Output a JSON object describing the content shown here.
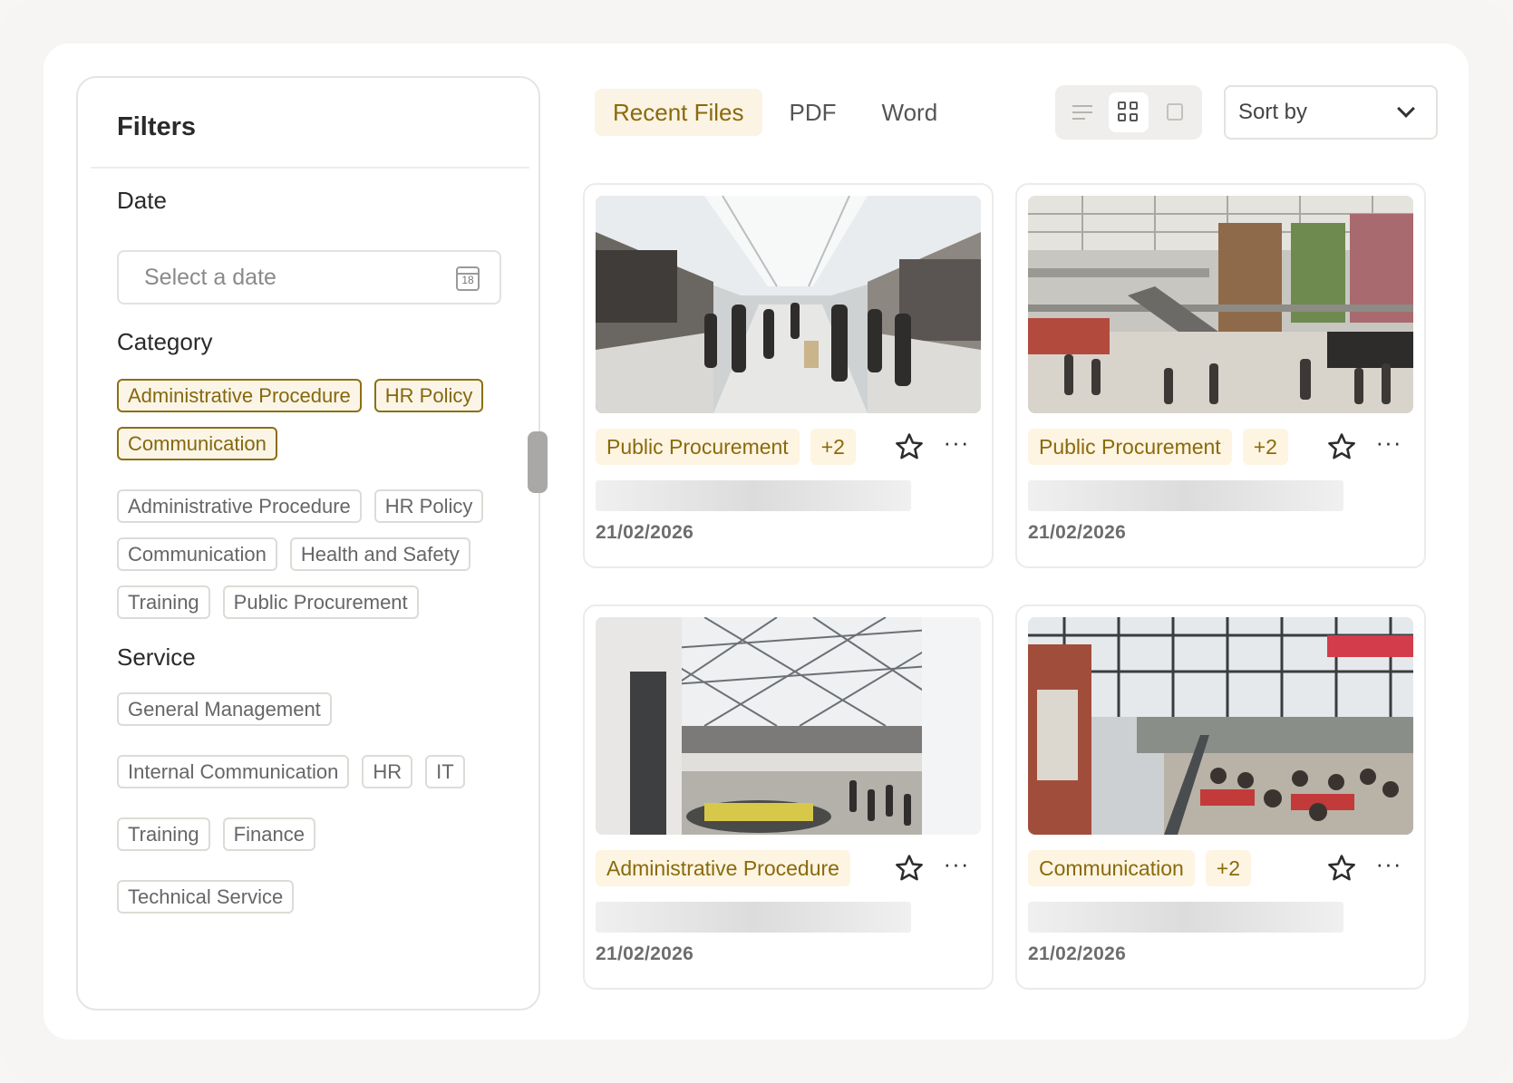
{
  "filters": {
    "title": "Filters",
    "date": {
      "label": "Date",
      "placeholder": "Select a date",
      "calendar_day": "18"
    },
    "category": {
      "label": "Category",
      "selected": [
        "Administrative Procedure",
        "HR Policy",
        "Communication"
      ],
      "options": [
        "Administrative Procedure",
        "HR Policy",
        "Communication",
        "Health and Safety",
        "Training",
        "Public Procurement"
      ]
    },
    "service": {
      "label": "Service",
      "options": [
        "General Management",
        "Internal Communication",
        "HR",
        "IT",
        "Training",
        "Finance",
        "Technical Service"
      ]
    }
  },
  "tabs": [
    {
      "label": "Recent Files",
      "active": true
    },
    {
      "label": "PDF",
      "active": false
    },
    {
      "label": "Word",
      "active": false
    }
  ],
  "view_toggle": {
    "active": "grid",
    "options": [
      "list",
      "grid",
      "single"
    ]
  },
  "sort": {
    "label": "Sort by",
    "icon": "chevron-down-icon"
  },
  "cards": [
    {
      "tag": "Public Procurement",
      "extra": "+2",
      "date": "21/02/2026",
      "image": "mall-corridor-photo"
    },
    {
      "tag": "Public Procurement",
      "extra": "+2",
      "date": "21/02/2026",
      "image": "mall-atrium-photo"
    },
    {
      "tag": "Administrative Procedure",
      "extra": "",
      "date": "21/02/2026",
      "image": "glass-dome-mall-photo"
    },
    {
      "tag": "Communication",
      "extra": "+2",
      "date": "21/02/2026",
      "image": "food-hall-photo"
    }
  ],
  "colors": {
    "accent": "#8a6a0c",
    "accent_bg": "#fdf4e2",
    "border": "#e6e4e0",
    "page_bg": "#f6f5f3"
  }
}
